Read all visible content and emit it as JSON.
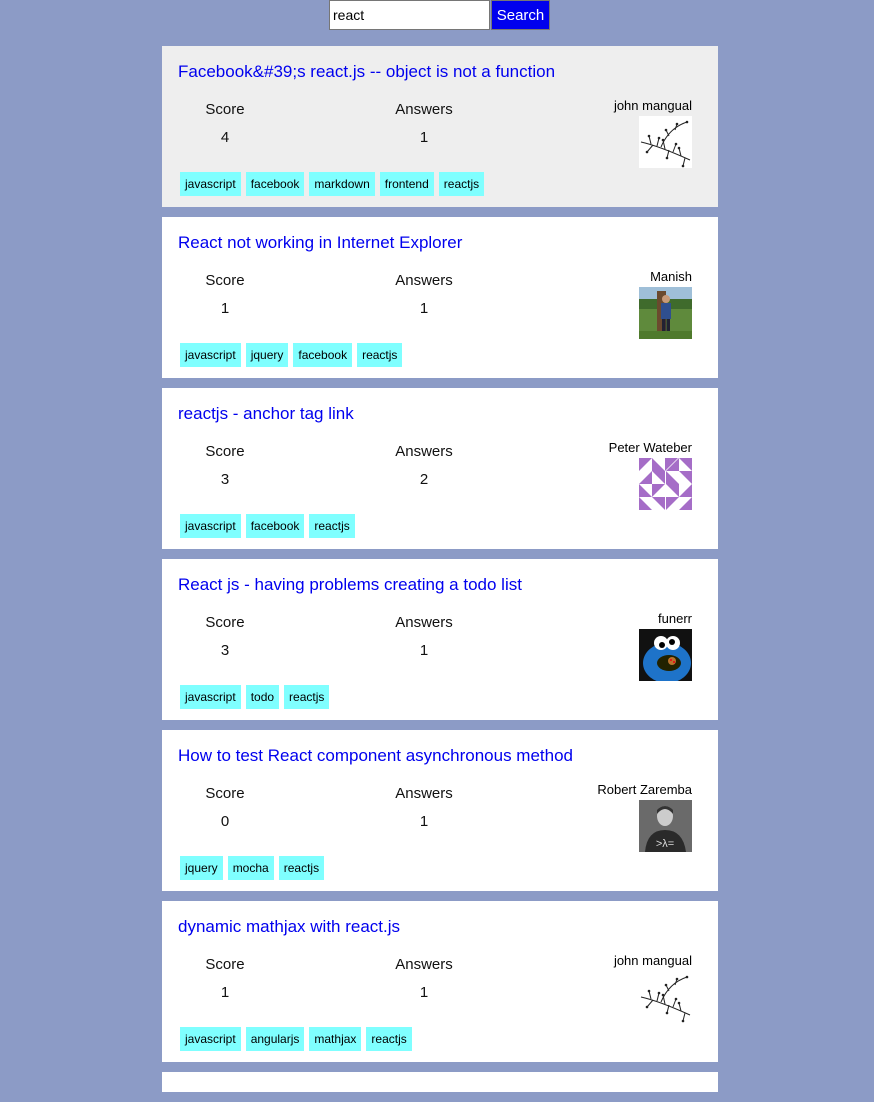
{
  "search": {
    "value": "react",
    "button_label": "Search"
  },
  "results": [
    {
      "title": "Facebook&#39;s react.js -- object is not a function",
      "score_label": "Score",
      "score": "4",
      "answers_label": "Answers",
      "answers": "1",
      "owner": "john mangual",
      "avatar": "branch-drawing-icon",
      "tags": [
        "javascript",
        "facebook",
        "markdown",
        "frontend",
        "reactjs"
      ]
    },
    {
      "title": "React not working in Internet Explorer",
      "score_label": "Score",
      "score": "1",
      "answers_label": "Answers",
      "answers": "1",
      "owner": "Manish",
      "avatar": "person-photo-icon",
      "tags": [
        "javascript",
        "jquery",
        "facebook",
        "reactjs"
      ]
    },
    {
      "title": "reactjs - anchor tag link",
      "score_label": "Score",
      "score": "3",
      "answers_label": "Answers",
      "answers": "2",
      "owner": "Peter Wateber",
      "avatar": "identicon-purple-icon",
      "tags": [
        "javascript",
        "facebook",
        "reactjs"
      ]
    },
    {
      "title": "React js - having problems creating a todo list",
      "score_label": "Score",
      "score": "3",
      "answers_label": "Answers",
      "answers": "1",
      "owner": "funerr",
      "avatar": "cookie-monster-icon",
      "tags": [
        "javascript",
        "todo",
        "reactjs"
      ]
    },
    {
      "title": "How to test React component asynchronous method",
      "score_label": "Score",
      "score": "0",
      "answers_label": "Answers",
      "answers": "1",
      "owner": "Robert Zaremba",
      "avatar": "person-bw-photo-icon",
      "tags": [
        "jquery",
        "mocha",
        "reactjs"
      ]
    },
    {
      "title": "dynamic mathjax with react.js",
      "score_label": "Score",
      "score": "1",
      "answers_label": "Answers",
      "answers": "1",
      "owner": "john mangual",
      "avatar": "branch-drawing-icon",
      "tags": [
        "javascript",
        "angularjs",
        "mathjax",
        "reactjs"
      ]
    }
  ],
  "colors": {
    "page_background": "#8c9bc6",
    "link": "#0000ee",
    "tag_background": "#7fffff",
    "highlight_card": "#eeeeee",
    "search_button": "#0000ee"
  }
}
